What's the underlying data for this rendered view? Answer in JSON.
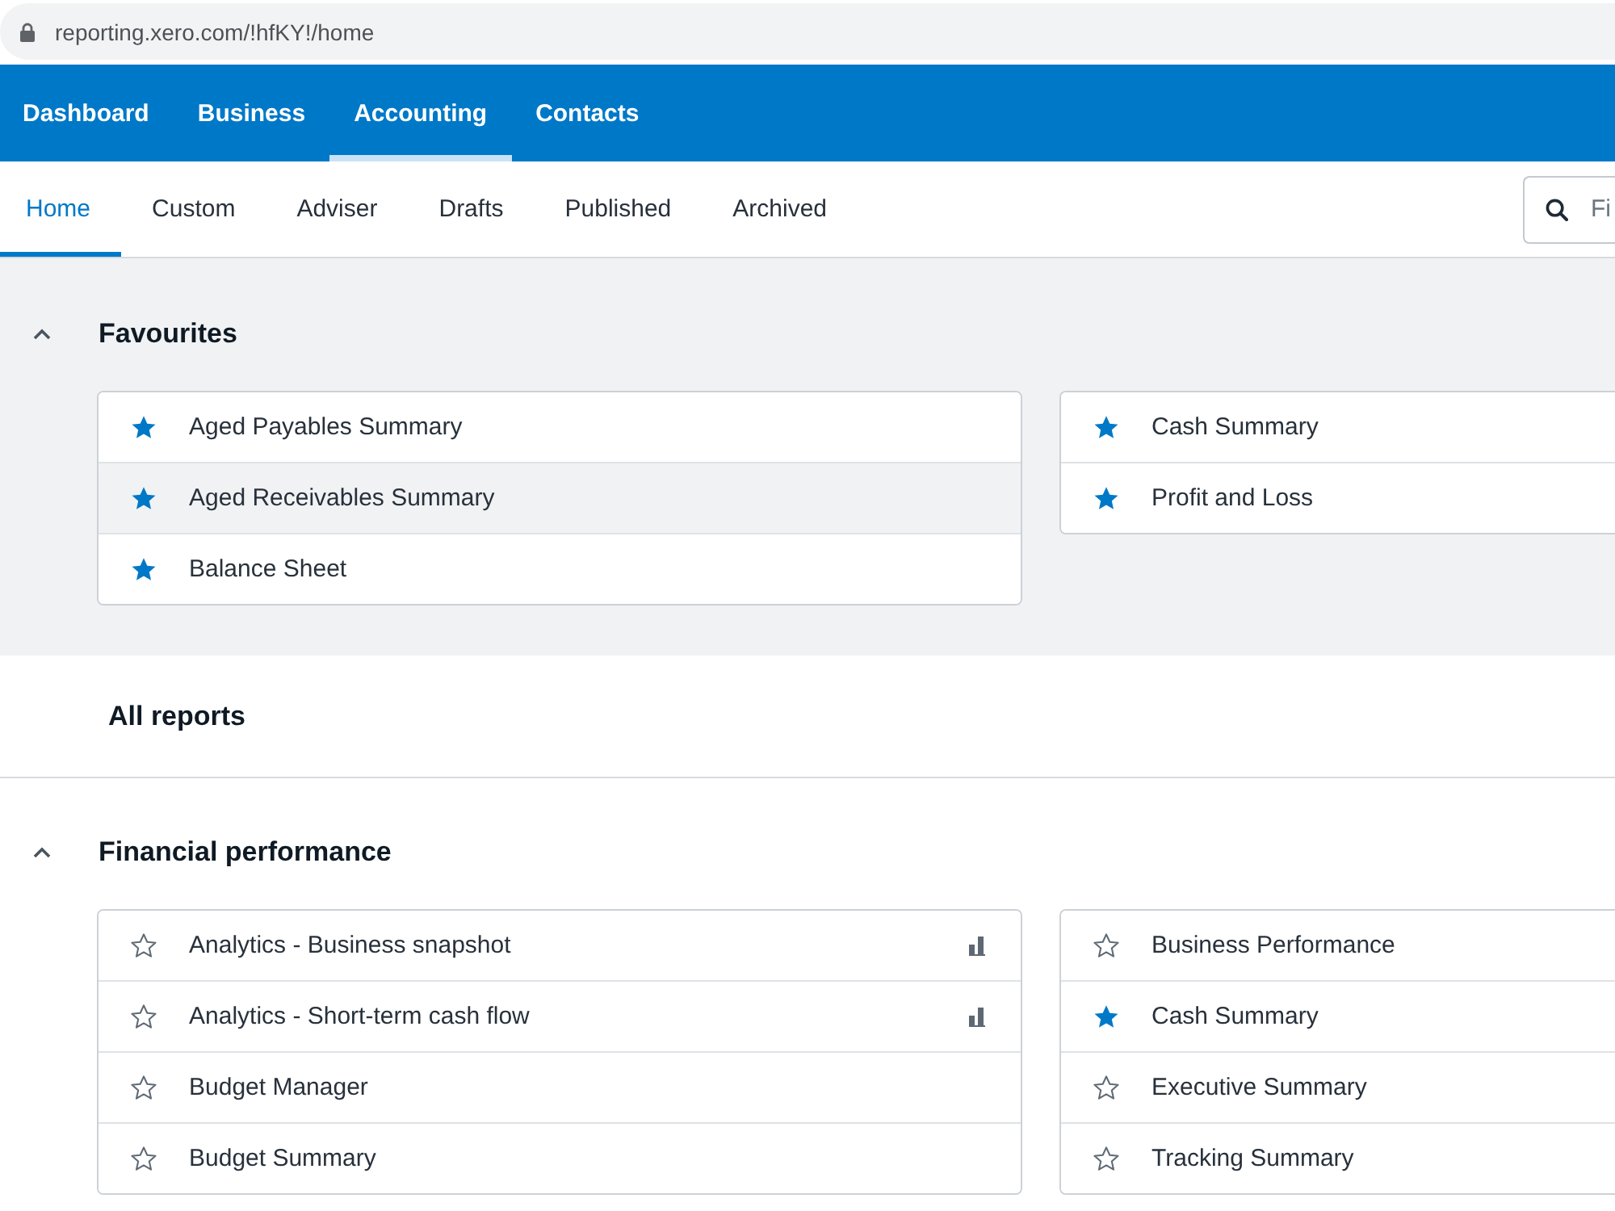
{
  "browser": {
    "url": "reporting.xero.com/!hfKY!/home"
  },
  "main_nav": [
    {
      "label": "Dashboard",
      "selected": false
    },
    {
      "label": "Business",
      "selected": false
    },
    {
      "label": "Accounting",
      "selected": true
    },
    {
      "label": "Contacts",
      "selected": false
    }
  ],
  "sub_tabs": [
    {
      "label": "Home",
      "selected": true
    },
    {
      "label": "Custom",
      "selected": false
    },
    {
      "label": "Adviser",
      "selected": false
    },
    {
      "label": "Drafts",
      "selected": false
    },
    {
      "label": "Published",
      "selected": false
    },
    {
      "label": "Archived",
      "selected": false
    }
  ],
  "search": {
    "placeholder": "Fi"
  },
  "favourites": {
    "title": "Favourites",
    "expanded": true,
    "columns": [
      [
        {
          "label": "Aged Payables Summary",
          "starred": true,
          "highlighted": false
        },
        {
          "label": "Aged Receivables Summary",
          "starred": true,
          "highlighted": true
        },
        {
          "label": "Balance Sheet",
          "starred": true,
          "highlighted": false
        }
      ],
      [
        {
          "label": "Cash Summary",
          "starred": true,
          "highlighted": false
        },
        {
          "label": "Profit and Loss",
          "starred": true,
          "highlighted": false
        }
      ]
    ]
  },
  "all_reports": {
    "title": "All reports"
  },
  "report_groups": [
    {
      "title": "Financial performance",
      "expanded": true,
      "columns": [
        [
          {
            "label": "Analytics - Business snapshot",
            "starred": false,
            "highlighted": false,
            "kind": "analytics"
          },
          {
            "label": "Analytics - Short-term cash flow",
            "starred": false,
            "highlighted": false,
            "kind": "analytics"
          },
          {
            "label": "Budget Manager",
            "starred": false,
            "highlighted": false,
            "kind": "report"
          },
          {
            "label": "Budget Summary",
            "starred": false,
            "highlighted": false,
            "kind": "report"
          }
        ],
        [
          {
            "label": "Business Performance",
            "starred": false,
            "highlighted": false,
            "kind": "report"
          },
          {
            "label": "Cash Summary",
            "starred": true,
            "highlighted": false,
            "kind": "report"
          },
          {
            "label": "Executive Summary",
            "starred": false,
            "highlighted": false,
            "kind": "report"
          },
          {
            "label": "Tracking Summary",
            "starred": false,
            "highlighted": false,
            "kind": "report"
          }
        ]
      ]
    }
  ]
}
